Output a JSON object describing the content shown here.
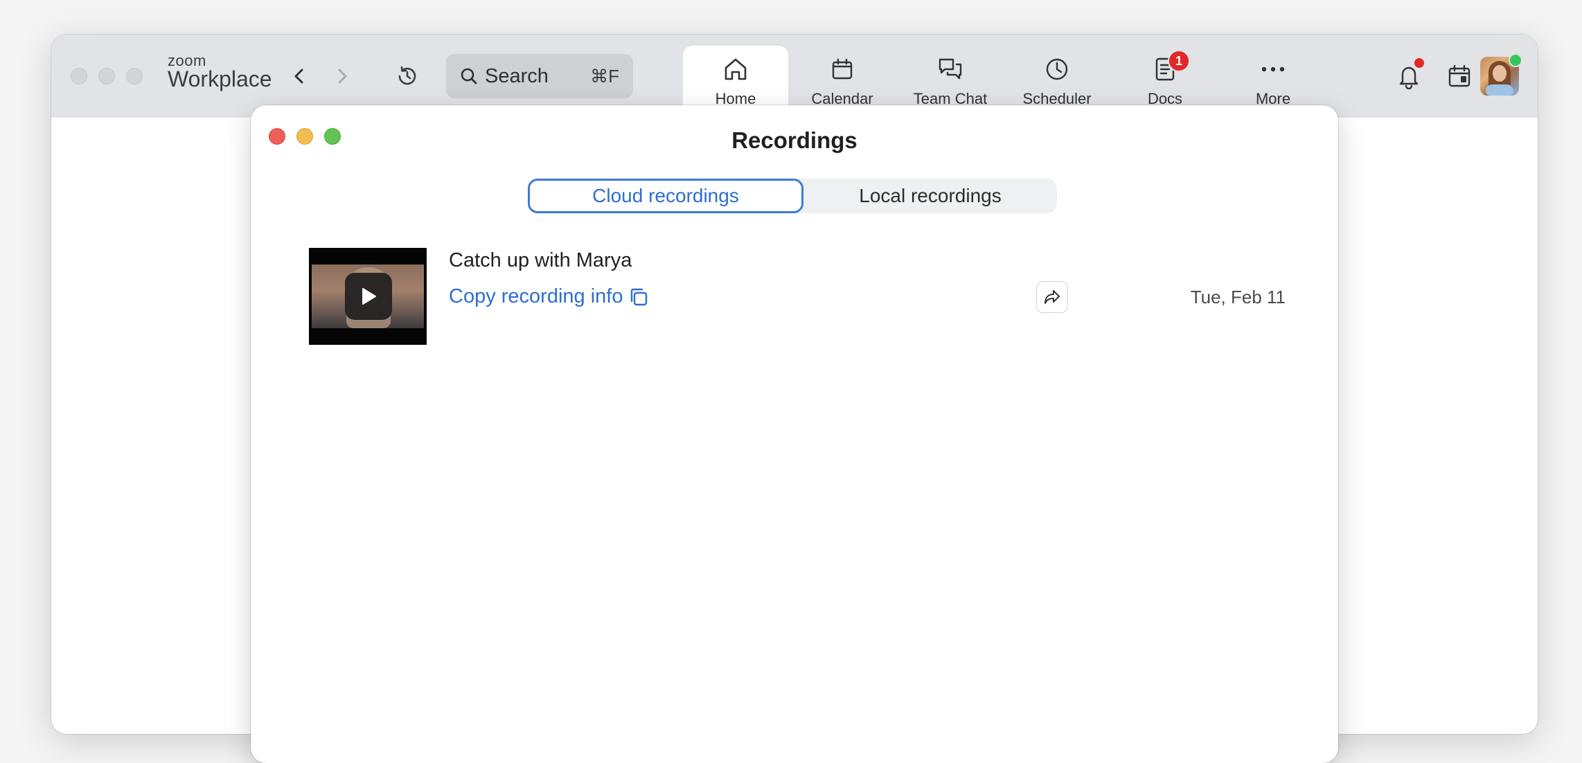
{
  "app": {
    "logo_top": "zoom",
    "logo_bottom": "Workplace"
  },
  "search": {
    "label": "Search",
    "shortcut": "⌘F"
  },
  "nav": {
    "tabs": [
      {
        "label": "Home",
        "icon": "home-icon",
        "active": true
      },
      {
        "label": "Calendar",
        "icon": "calendar-icon"
      },
      {
        "label": "Team Chat",
        "icon": "chat-icon"
      },
      {
        "label": "Scheduler",
        "icon": "clock-icon"
      },
      {
        "label": "Docs",
        "icon": "document-icon",
        "badge": "1"
      },
      {
        "label": "More",
        "icon": "ellipsis-icon"
      }
    ]
  },
  "dialog": {
    "title": "Recordings",
    "segments": {
      "cloud": "Cloud recordings",
      "local": "Local recordings"
    },
    "recordings": [
      {
        "title": "Catch up with Marya",
        "copy_label": "Copy recording info",
        "date": "Tue, Feb 11"
      }
    ]
  },
  "colors": {
    "accent": "#2e6dd1",
    "badge": "#e02828",
    "close": "#ed5f57",
    "minimize": "#f4bd4f",
    "maximize": "#5fc454",
    "online": "#34c759"
  }
}
